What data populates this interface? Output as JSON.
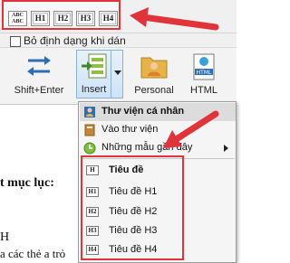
{
  "heading_icons": [
    {
      "label": "ABC\nABC"
    },
    {
      "label": "H1"
    },
    {
      "label": "H2"
    },
    {
      "label": "H3"
    },
    {
      "label": "H4"
    }
  ],
  "checkbox": {
    "label": "Bỏ định dạng khi dán",
    "checked": false
  },
  "ribbon": {
    "shift_enter": "Shift+Enter",
    "insert": "Insert",
    "personal": "Personal",
    "html": "HTML",
    "html_icon_text": "HTML"
  },
  "menu": {
    "header": "Thư viện cá nhân",
    "item_library": "Vào thư viện",
    "item_recent": "Những mẫu gần đây",
    "headings": [
      {
        "icon": "H",
        "label": "Tiêu đề"
      },
      {
        "icon": "H1",
        "label": "Tiêu đề H1"
      },
      {
        "icon": "H2",
        "label": "Tiêu đề H2"
      },
      {
        "icon": "H3",
        "label": "Tiêu đề H3"
      },
      {
        "icon": "H4",
        "label": "Tiêu đề H4"
      }
    ]
  },
  "document": {
    "line1": "t mục lục:",
    "line2": "H",
    "line3": "a các thẻ a trỏ"
  },
  "colors": {
    "highlight": "#e0333a",
    "accent": "#8ab0d6"
  }
}
